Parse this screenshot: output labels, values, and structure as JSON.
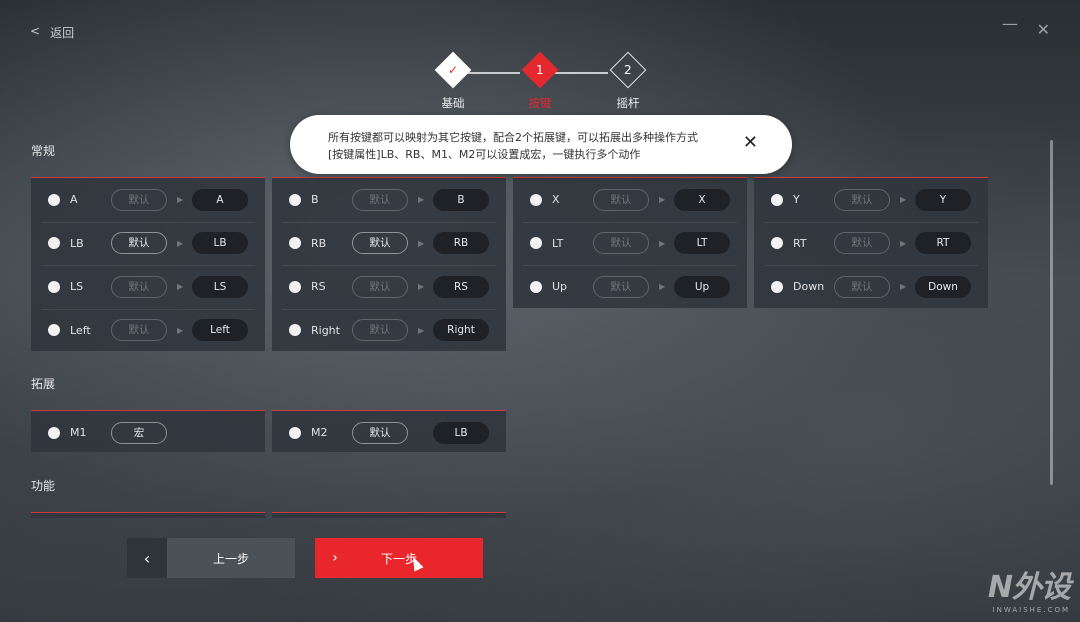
{
  "back": {
    "icon": "<",
    "label": "返回"
  },
  "window": {
    "minimize": "—",
    "close": "✕"
  },
  "stepper": {
    "steps": [
      {
        "label": "基础",
        "mark": "✓",
        "state": "done"
      },
      {
        "label": "按键",
        "mark": "1",
        "state": "active"
      },
      {
        "label": "摇杆",
        "mark": "2",
        "state": "pending"
      }
    ]
  },
  "tooltip": {
    "line1": "所有按键都可以映射为其它按键，配合2个拓展键，可以拓展出多种操作方式",
    "line2": "[按键属性]LB、RB、M1、M2可以设置成宏，一键执行多个动作",
    "close": "✕"
  },
  "sections": {
    "general": "常规",
    "extend": "拓展",
    "function": "功能"
  },
  "general_columns": [
    [
      {
        "key": "A",
        "default": "默认",
        "value": "A",
        "default_active": false
      },
      {
        "key": "LB",
        "default": "默认",
        "value": "LB",
        "default_active": true
      },
      {
        "key": "LS",
        "default": "默认",
        "value": "LS",
        "default_active": false
      },
      {
        "key": "Left",
        "default": "默认",
        "value": "Left",
        "default_active": false
      }
    ],
    [
      {
        "key": "B",
        "default": "默认",
        "value": "B",
        "default_active": false
      },
      {
        "key": "RB",
        "default": "默认",
        "value": "RB",
        "default_active": true
      },
      {
        "key": "RS",
        "default": "默认",
        "value": "RS",
        "default_active": false
      },
      {
        "key": "Right",
        "default": "默认",
        "value": "Right",
        "default_active": false
      }
    ],
    [
      {
        "key": "X",
        "default": "默认",
        "value": "X",
        "default_active": false
      },
      {
        "key": "LT",
        "default": "默认",
        "value": "LT",
        "default_active": false
      },
      {
        "key": "Up",
        "default": "默认",
        "value": "Up",
        "default_active": false
      }
    ],
    [
      {
        "key": "Y",
        "default": "默认",
        "value": "Y",
        "default_active": false
      },
      {
        "key": "RT",
        "default": "默认",
        "value": "RT",
        "default_active": false
      },
      {
        "key": "Down",
        "default": "默认",
        "value": "Down",
        "default_active": false
      }
    ]
  ],
  "extend_items": [
    {
      "key": "M1",
      "default": "宏",
      "value": "",
      "default_active": true
    },
    {
      "key": "M2",
      "default": "默认",
      "value": "LB",
      "default_active": true
    }
  ],
  "buttons": {
    "prev_icon": "‹",
    "prev": "上一步",
    "next_icon": "›",
    "next": "下一步"
  },
  "watermark": {
    "brand": "N外设",
    "domain": "INWAISHE.COM"
  },
  "colors": {
    "accent": "#e5282d"
  }
}
